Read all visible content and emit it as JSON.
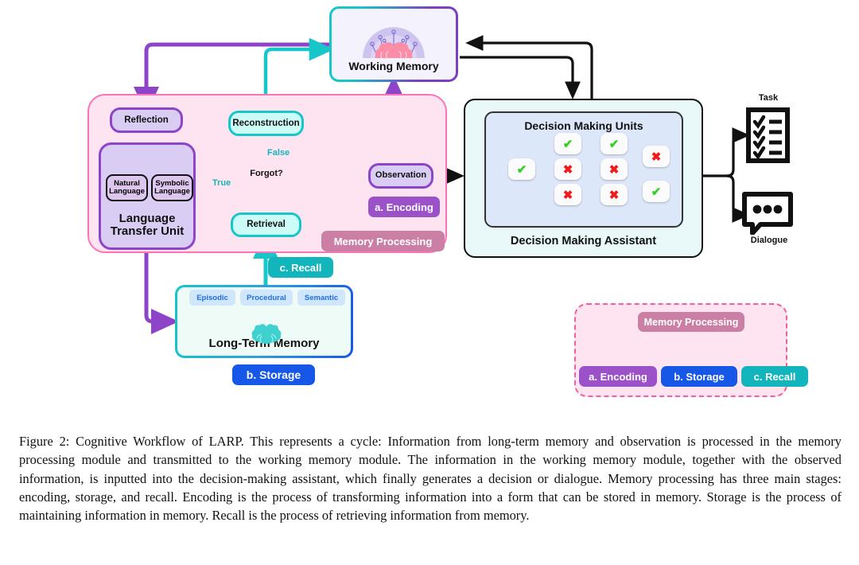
{
  "figure": {
    "memory_processing": {
      "panel_label": "Memory Processing",
      "reflection": "Reflection",
      "language_transfer_unit": "Language\nTransfer Unit",
      "natural_language": "Natural\nLanguage",
      "symbolic_language": "Symbolic\nLanguage",
      "reconstruction": "Reconstruction",
      "forgot": "Forgot?",
      "retrieval": "Retrieval",
      "observation": "Observation",
      "label_false": "False",
      "label_true": "True",
      "badge_encoding": "a. Encoding",
      "badge_recall": "c. Recall"
    },
    "working_memory": {
      "title": "Working Memory",
      "icon": "brain-icon"
    },
    "long_term_memory": {
      "title": "Long-Term Memory",
      "badge_storage": "b. Storage",
      "icon": "brain-icon",
      "tags": [
        "Episodic",
        "Procedural",
        "Semantic"
      ]
    },
    "decision": {
      "assistant_title": "Decision Making Assistant",
      "units_title": "Decision Making Units",
      "nodes": [
        {
          "id": "root",
          "mark": "✔",
          "state": "yes"
        },
        {
          "id": "c1r1",
          "mark": "✔",
          "state": "yes"
        },
        {
          "id": "c1r2",
          "mark": "✖",
          "state": "no"
        },
        {
          "id": "c1r3",
          "mark": "✖",
          "state": "no"
        },
        {
          "id": "c2r1",
          "mark": "✔",
          "state": "yes"
        },
        {
          "id": "c2r2",
          "mark": "✖",
          "state": "no"
        },
        {
          "id": "c2r3",
          "mark": "✖",
          "state": "no"
        },
        {
          "id": "c3r1",
          "mark": "✖",
          "state": "no"
        },
        {
          "id": "c3r2",
          "mark": "✔",
          "state": "yes"
        }
      ]
    },
    "outputs": {
      "task_label": "Task",
      "dialogue_label": "Dialogue",
      "task_icon": "checklist-icon",
      "dialogue_icon": "speech-bubble-icon"
    },
    "legend": {
      "root": "Memory Processing",
      "encoding": "a. Encoding",
      "storage": "b. Storage",
      "recall": "c. Recall"
    },
    "colors": {
      "pink_panel_bg": "#fde4f0",
      "pink_panel_border": "#fb74b8",
      "purple": "#8e44c8",
      "purple_fill": "#d9cdf3",
      "teal": "#16c6c9",
      "teal_fill": "#ccfcf7",
      "blue": "#1757e8",
      "encoding_badge": "#9b51c8",
      "storage_badge": "#1757e8",
      "recall_badge": "#12b5bb",
      "memproc_badge": "#cc7fa5",
      "check_green": "#2fd11f",
      "cross_red": "#f11a1a"
    }
  },
  "caption": "Figure 2: Cognitive Workflow of LARP. This represents a cycle: Information from long-term memory and observation is processed in the memory processing module and transmitted to the working memory module. The information in the working memory module, together with the observed information, is inputted into the decision-making assistant, which finally generates a decision or dialogue. Memory processing has three main stages: encoding, storage, and recall. Encoding is the process of transforming information into a form that can be stored in memory. Storage is the process of maintaining information in memory. Recall is the process of retrieving information from memory."
}
